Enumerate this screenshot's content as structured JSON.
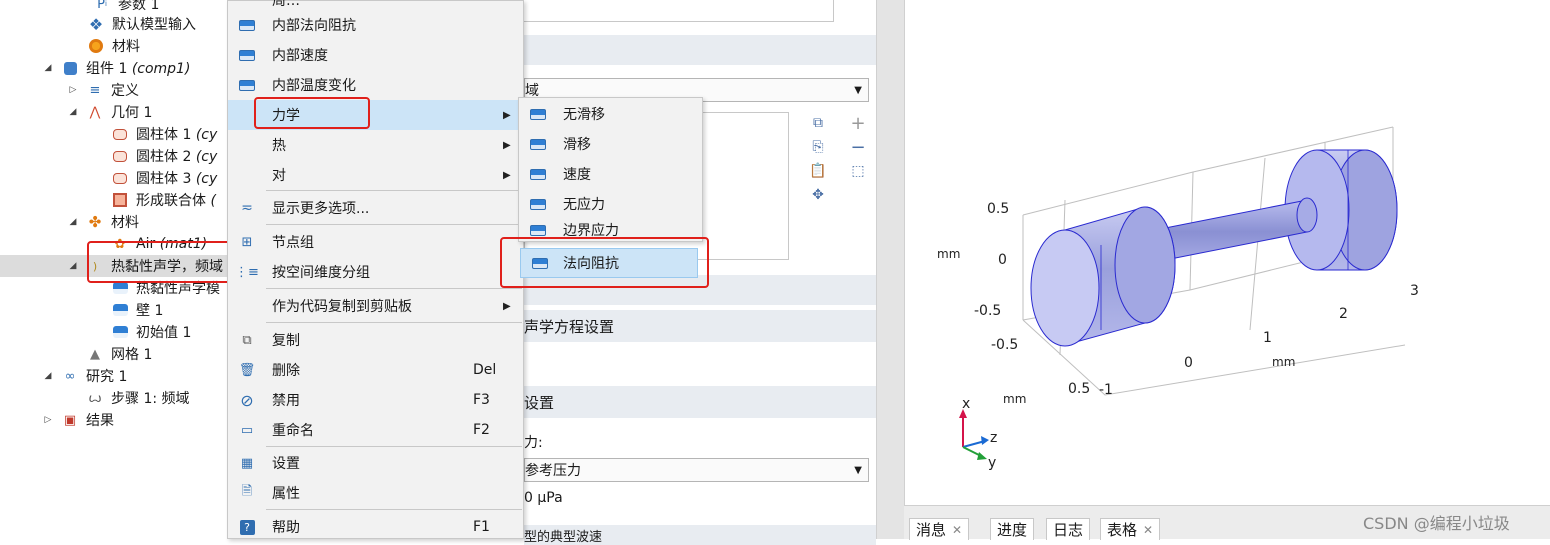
{
  "tree": {
    "rows": [
      {
        "label": "参数 1",
        "italic": "",
        "icon": "parameter-icon"
      },
      {
        "label": "默认模型输入",
        "italic": "",
        "icon": "model-input-icon"
      },
      {
        "label": "材料",
        "italic": "",
        "icon": "materials-icon"
      },
      {
        "label": "组件 1 ",
        "italic": "(comp1)",
        "icon": "component-icon"
      },
      {
        "label": "定义",
        "italic": "",
        "icon": "definitions-icon"
      },
      {
        "label": "几何 1",
        "italic": "",
        "icon": "geometry-icon"
      },
      {
        "label": "圆柱体 1 ",
        "italic": "(cy",
        "icon": "cylinder-icon"
      },
      {
        "label": "圆柱体 2 ",
        "italic": "(cy",
        "icon": "cylinder-icon"
      },
      {
        "label": "圆柱体 3 ",
        "italic": "(cy",
        "icon": "cylinder-icon"
      },
      {
        "label": "形成联合体 ",
        "italic": "(",
        "icon": "form-union-icon"
      },
      {
        "label": "材料",
        "italic": "",
        "icon": "materials-icon"
      },
      {
        "label": "Air ",
        "italic": "(mat1)",
        "icon": "air-material-icon"
      },
      {
        "label": "热黏性声学，频域",
        "italic": "",
        "icon": "physics-icon"
      },
      {
        "label": "热黏性声学模",
        "italic": "",
        "icon": "physics-feature-icon"
      },
      {
        "label": "壁 1",
        "italic": "",
        "icon": "wall-icon"
      },
      {
        "label": "初始值 1",
        "italic": "",
        "icon": "initial-values-icon"
      },
      {
        "label": "网格 1",
        "italic": "",
        "icon": "mesh-icon"
      },
      {
        "label": "研究 1",
        "italic": "",
        "icon": "study-icon"
      },
      {
        "label": "步骤 1: 频域",
        "italic": "",
        "icon": "frequency-step-icon"
      },
      {
        "label": "结果",
        "italic": "",
        "icon": "results-icon"
      }
    ]
  },
  "context_menu": {
    "top_partial": "周…",
    "items": {
      "internal_normal_impedance": "内部法向阻抗",
      "internal_velocity": "内部速度",
      "internal_temperature_variation": "内部温度变化",
      "mechanical": "力学",
      "thermal": "热",
      "pair": "对",
      "show_more_options": "显示更多选项...",
      "node_group": "节点组",
      "group_by_space_dimension": "按空间维度分组",
      "copy_as_code": "作为代码复制到剪贴板",
      "copy": "复制",
      "delete": "删除",
      "delete_shortcut": "Del",
      "disable": "禁用",
      "disable_shortcut": "F3",
      "rename": "重命名",
      "rename_shortcut": "F2",
      "settings": "设置",
      "properties": "属性",
      "help": "帮助",
      "help_shortcut": "F1"
    }
  },
  "submenu": {
    "items": [
      "无滑移",
      "滑移",
      "速度",
      "无应力",
      "边界应力",
      "法向阻抗"
    ]
  },
  "settings_panel": {
    "domain_combo": "域",
    "section_equation": "声学方程设置",
    "section_settings": "设置",
    "pressure_label": "力:",
    "pressure_combo": "参考压力",
    "pressure_value": "0 μPa",
    "bottom_partial": "型的典型波速"
  },
  "graphics": {
    "axis_ticks_x": [
      "-1",
      "0",
      "1",
      "2",
      "3"
    ],
    "axis_ticks_left": [
      "0.5",
      "0",
      "-0.5",
      "-0.5"
    ],
    "axis_tick_bottom_left": "0.5",
    "unit_labels": [
      "mm",
      "mm",
      "mm"
    ],
    "triad": {
      "x": "x",
      "y": "y",
      "z": "z"
    }
  },
  "bottom_tabs": [
    "消息",
    "进度",
    "日志",
    "表格"
  ],
  "watermark": "CSDN @编程小垃圾",
  "colors": {
    "highlight": "#cce4f7",
    "annotation_red": "#e0201b",
    "geometry": "#aab0e8"
  }
}
